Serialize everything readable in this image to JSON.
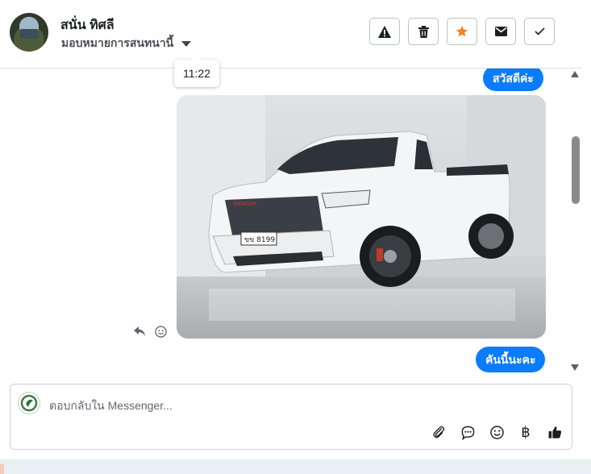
{
  "header": {
    "contact_name": "สนั่น ทิศลี",
    "assign_label": "มอบหมายการสนทนานี้",
    "icons": [
      "warning-icon",
      "trash-icon",
      "star-icon",
      "mail-icon",
      "check-icon"
    ],
    "star_color": "#f5821f"
  },
  "tooltip": {
    "time": "11:22"
  },
  "messages": [
    {
      "sender": "page",
      "type": "text",
      "text": "สวัสดีค่ะ"
    },
    {
      "sender": "page",
      "type": "image",
      "image_desc_icon": "pickup-truck-photo",
      "plate_text": "ขข 8199",
      "grille_text": "RANGER"
    },
    {
      "sender": "page",
      "type": "text",
      "text": "คันนี้นะคะ"
    }
  ],
  "message_actions": [
    "reply-icon",
    "emoji-react-icon"
  ],
  "composer": {
    "placeholder": "ตอบกลับใน Messenger...",
    "tools": [
      "attachment-icon",
      "saved-reply-icon",
      "emoji-icon",
      "payment-baht-icon",
      "like-icon"
    ],
    "baht_symbol": "฿"
  },
  "colors": {
    "accent": "#0a7cff",
    "bubble_text": "#ffffff"
  }
}
